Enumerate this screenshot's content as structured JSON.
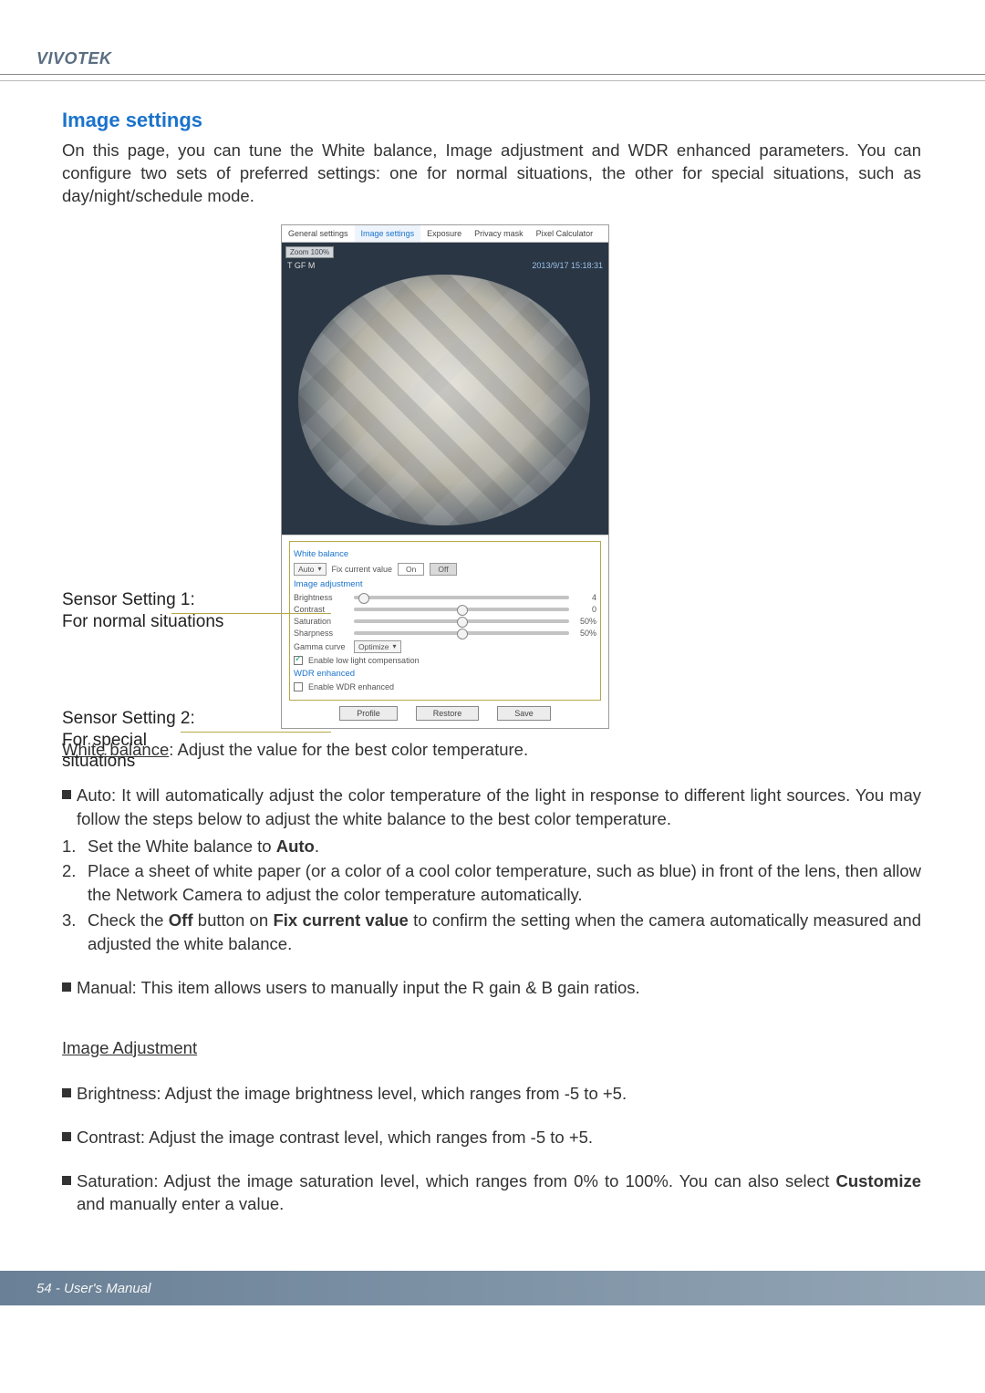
{
  "brand": "VIVOTEK",
  "section_title": "Image settings",
  "intro": "On this page, you can tune the White balance, Image adjustment and WDR enhanced parameters. You can configure two sets of preferred settings: one for normal situations, the other for special situations, such as day/night/schedule mode.",
  "callouts": {
    "s1_line1": "Sensor Setting 1:",
    "s1_line2": "For normal situations",
    "s2_line1": "Sensor Setting 2:",
    "s2_line2": "For special",
    "s2_line3": "situations"
  },
  "panel": {
    "tabs": {
      "general": "General settings",
      "image": "Image settings",
      "exposure": "Exposure",
      "privacy": "Privacy mask",
      "pixel": "Pixel Calculator"
    },
    "zoom": "Zoom 100%",
    "video_title": "T GF M",
    "video_time": "2013/9/17 15:18:31",
    "white_balance": {
      "title": "White balance",
      "mode_label": "Auto",
      "fix_label": "Fix current value",
      "on": "On",
      "off": "Off"
    },
    "image_adjustment": {
      "title": "Image adjustment",
      "brightness": {
        "label": "Brightness",
        "value": "4"
      },
      "contrast": {
        "label": "Contrast",
        "value": "0"
      },
      "saturation": {
        "label": "Saturation",
        "value": "50%"
      },
      "sharpness": {
        "label": "Sharpness",
        "value": "50%"
      },
      "gamma_label": "Gamma curve",
      "gamma_value": "Optimize",
      "lowlight_label": "Enable low light compensation"
    },
    "wdr": {
      "title": "WDR enhanced",
      "enable_label": "Enable WDR enhanced"
    },
    "buttons": {
      "profile": "Profile",
      "restore": "Restore",
      "save": "Save"
    }
  },
  "wb_heading": "White balance",
  "wb_text": ": Adjust the value for the best color temperature.",
  "auto_bullet": "Auto: It will automatically adjust the color temperature of the light in response to different light sources. You may follow the steps below to adjust the white balance to the best color temperature.",
  "steps": {
    "s1a": "Set the White balance to ",
    "s1b": "Auto",
    "s1c": ".",
    "s2": "Place a sheet of white paper (or a color of a cool color temperature, such as blue) in front of the lens, then allow the Network Camera to adjust the color temperature automatically.",
    "s3a": "Check the ",
    "s3b": "Off",
    "s3c": " button on ",
    "s3d": "Fix current value",
    "s3e": " to confirm the setting when the camera automatically measured and adjusted the white balance."
  },
  "manual_bullet": "Manual: This item allows users to manually input the R gain & B gain ratios.",
  "ia_heading": "Image Adjustment",
  "ia_brightness": "Brightness: Adjust the image brightness level, which ranges from -5 to +5.",
  "ia_contrast": "Contrast: Adjust the image contrast level, which ranges from -5 to +5.",
  "ia_saturation_a": "Saturation: Adjust the image saturation level, which ranges from 0% to 100%. You can also select ",
  "ia_saturation_b": "Customize",
  "ia_saturation_c": " and manually enter a value.",
  "footer": "54 - User's Manual"
}
